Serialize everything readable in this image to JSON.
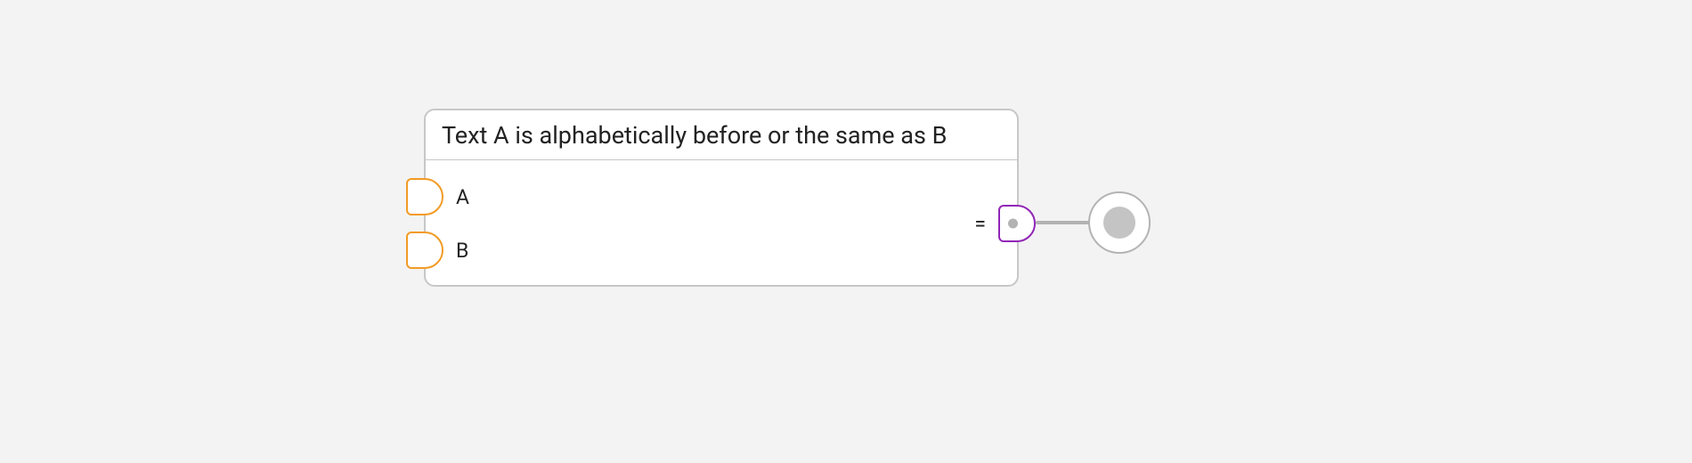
{
  "node": {
    "title": "Text A is alphabetically before or the same as B",
    "inputs": [
      {
        "label": "A"
      },
      {
        "label": "B"
      }
    ],
    "output": {
      "label": "="
    }
  }
}
